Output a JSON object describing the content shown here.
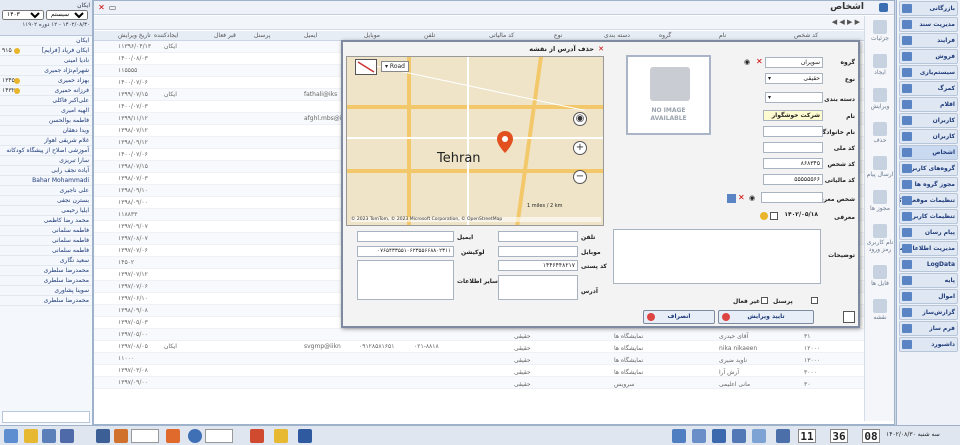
{
  "window_title": "اشخاص",
  "left_panel": {
    "title": "ایکان",
    "select_main": "ایکان سیستم",
    "select_year": "۱۴۰۳",
    "date_line": "۱۴۰۲/۰۸/۳۰ - ۱۲ دوره ۱۱۹۰۲",
    "rows": [
      {
        "text": "ایکان",
        "num": ""
      },
      {
        "text": "ایکان فریاد [فرایم]",
        "num": "۹۱۵"
      },
      {
        "text": "نادیا امینی",
        "num": ""
      },
      {
        "text": "شهرام‌نژاد جمیری",
        "num": ""
      },
      {
        "text": "بهزاد حمیری",
        "num": "۱۳۴۵"
      },
      {
        "text": "فرزانه حمیری",
        "num": "۱۴۳۲"
      },
      {
        "text": "علی‌اکبر فاکلی",
        "num": ""
      },
      {
        "text": "الهیه امیری",
        "num": ""
      },
      {
        "text": "فاطمه بوالحسن",
        "num": ""
      },
      {
        "text": "ویدا دهقان",
        "num": ""
      },
      {
        "text": "غلام شریفی اهواز",
        "num": ""
      },
      {
        "text": "آموزشی اصلاح از پیشگاه کودکانه",
        "num": ""
      },
      {
        "text": "سارا تبریزی",
        "num": ""
      },
      {
        "text": "آیاده نجف رابی",
        "num": ""
      },
      {
        "text": "Bahar Mohammadi",
        "num": ""
      },
      {
        "text": "علی ناجیری",
        "num": ""
      },
      {
        "text": "بسترن نجفی",
        "num": ""
      },
      {
        "text": "ایلیا رحیمی",
        "num": ""
      },
      {
        "text": "محمد رضا کاظمی",
        "num": ""
      },
      {
        "text": "فاطمه سلمانی",
        "num": ""
      },
      {
        "text": "فاطمه سلمانی",
        "num": ""
      },
      {
        "text": "فاطمه سلمانی",
        "num": ""
      },
      {
        "text": "سعید نگاری",
        "num": ""
      },
      {
        "text": "محمدرضا سلطری",
        "num": ""
      },
      {
        "text": "محمدرضا سلطری",
        "num": ""
      },
      {
        "text": "سوینا پشاوری",
        "num": ""
      },
      {
        "text": "محمدرضا سلطری",
        "num": ""
      }
    ]
  },
  "grid": {
    "headers": [
      "تاریخ ویرایش",
      "ایجادکننده",
      "قبر فعال",
      "پرسنل",
      "ایمیل",
      "موبایل",
      "تلفن",
      "کد مالیاتی",
      "نوع",
      "دسته بندی",
      "گروه",
      "نام",
      "کد شخص"
    ],
    "rows": [
      [
        "۱۱۳۹۶/۰۴/۱۳",
        "ایکان",
        "",
        "",
        "",
        "",
        ""
      ],
      [
        "۱۴۰۰/۰۸/۰۳",
        "",
        "",
        "",
        "",
        "",
        ""
      ],
      [
        "۱۱۵۵۵۵",
        "",
        "",
        "",
        "",
        "",
        ""
      ],
      [
        "۱۴۰۰/۰۷/۰۶",
        "",
        "",
        "",
        "",
        "",
        ""
      ],
      [
        "۱۳۹۹/۰۷/۱۵",
        "ایکان",
        "",
        "",
        "fathali@iks",
        "",
        ""
      ],
      [
        "۱۴۰۰/۰۷/۰۳",
        "",
        "",
        "",
        "",
        "",
        ""
      ],
      [
        "۱۳۹۹/۱۱/۱۲",
        "",
        "",
        "",
        "afghl.mbs@iks",
        "",
        ""
      ],
      [
        "۱۳۹۸/۰۷/۱۲",
        "",
        "",
        "",
        "",
        "",
        ""
      ],
      [
        "۱۳۹۸/۰۹/۱۲",
        "",
        "",
        "",
        "",
        "",
        ""
      ],
      [
        "۱۴۰۰/۰۷/۰۶",
        "",
        "",
        "",
        "",
        "",
        ""
      ],
      [
        "۱۳۹۸/۰۷/۱۵",
        "",
        "",
        "",
        "",
        "",
        ""
      ],
      [
        "۱۳۹۸/۰۷/۰۳",
        "",
        "",
        "",
        "",
        "",
        ""
      ],
      [
        "۱۳۹۸/۰۹/۱۰",
        "",
        "",
        "",
        "",
        "",
        ""
      ],
      [
        "۱۳۹۸/۰۹/۰۰",
        "",
        "",
        "",
        "",
        "",
        ""
      ],
      [
        "۱۱۸۸۳۳",
        "",
        "",
        "",
        "",
        "",
        ""
      ],
      [
        "۱۳۹۷/۰۹/۰۷",
        "",
        "",
        "",
        "",
        "",
        ""
      ],
      [
        "۱۳۹۷/۰۸/۰۷",
        "",
        "",
        "",
        "",
        "",
        ""
      ],
      [
        "۱۳۹۷/۰۷/۰۶",
        "",
        "",
        "",
        "",
        "",
        ""
      ],
      [
        "۱۴۵۰۲",
        "",
        "",
        "",
        "",
        "",
        ""
      ],
      [
        "۱۳۹۷/۰۷/۱۲",
        "",
        "",
        "",
        "",
        "",
        ""
      ],
      [
        "۱۳۹۷/۰۷/۰۶",
        "",
        "",
        "",
        "",
        "",
        ""
      ],
      [
        "۱۳۹۷/۰۶/۱۰",
        "",
        "",
        "",
        "",
        "",
        ""
      ],
      [
        "۱۳۹۸/۰۹/۰۸",
        "",
        "",
        "",
        "",
        "",
        ""
      ],
      [
        "۱۳۹۷/۰۵/۰۳",
        "",
        "",
        "",
        "",
        "",
        ""
      ],
      [
        "۱۳۹۷/۰۵/۰۰",
        "",
        "",
        "",
        "",
        "",
        ""
      ],
      [
        "۱۳۹۷/۰۸/۰۵",
        "ایکان",
        "",
        "",
        "svgmp@iikn",
        "۰۹۱۲۸۵۸۱۶۵۱",
        "۰۲۱-۸۸۱۸"
      ],
      [
        "۱۱۰۰۰",
        "",
        "",
        "",
        "",
        "",
        ""
      ],
      [
        "۱۳۹۷/۰۳/۰۸",
        "",
        "",
        "",
        "",
        "",
        ""
      ],
      [
        "۱۳۹۷/۰۹/۰۰",
        "",
        "",
        "",
        "",
        "",
        ""
      ]
    ],
    "bottom_rows": [
      {
        "code": "۳۱",
        "name": "آقای حیدری",
        "group": "نمایشگاه ها",
        "type": "حقیقی"
      },
      {
        "code": "۱۲۰۰۰",
        "name": "nika nikaeen",
        "group": "نمایشگاه ها",
        "type": "حقیقی"
      },
      {
        "code": "۱۳۰۰۰",
        "name": "ناوید ضیری",
        "group": "نمایشگاه ها",
        "type": "حقیقی"
      },
      {
        "code": "۳۰۰۰",
        "name": "آرش آرا",
        "group": "نمایشگاه ها",
        "type": "حقیقی"
      },
      {
        "code": "۳۰",
        "name": "مانی اعلیمی",
        "group": "سرویس",
        "type": "حقیقی"
      }
    ]
  },
  "actions": [
    {
      "label": "جزئیات",
      "icon": "details-icon"
    },
    {
      "label": "ایجاد",
      "icon": "create-icon"
    },
    {
      "label": "ویرایش",
      "icon": "edit-icon"
    },
    {
      "label": "حذف",
      "icon": "delete-icon"
    },
    {
      "label": "ارسال پیام",
      "icon": "message-icon"
    },
    {
      "label": "مجوز ها",
      "icon": "permissions-icon"
    },
    {
      "label": "نام کاربری رمز ورود",
      "icon": "login-icon"
    },
    {
      "label": "فایل ها",
      "icon": "files-icon"
    },
    {
      "label": "نقشه",
      "icon": "map-icon"
    }
  ],
  "right_nav": [
    "بازرگانی",
    "مدیریت سند",
    "فرایند",
    "فروش",
    "سیستم‌یاری",
    "کمرگ",
    "اقلام",
    "کاربران",
    "کاربران",
    "اشخاص",
    "گروه‌های کاربری",
    "مجوز گروه ها",
    "تنظیمات موقعیت کاربران",
    "تنظیمات کاربران",
    "پیام رسان",
    "مدیریت اطلاعات سیستم",
    "LogData",
    "پایه",
    "اموال",
    "گزارش‌ساز",
    "فرم ساز",
    "داشبورد"
  ],
  "dialog": {
    "map_title": "حذف آدرس از نقشه",
    "map_type": "Road",
    "map_city": "Tehran",
    "map_attrib": "© 2023 TomTom, © 2023 Microsoft Corporation, © OpenStreetMap",
    "map_scale_km": "2 km",
    "map_scale_mi": "1 miles",
    "no_image": "NO IMAGE",
    "no_image_sub": "AVAILABLE",
    "labels": {
      "group": "گروه",
      "type": "نوع",
      "category": "دسته بندی",
      "name": "نام",
      "family": "نام خانوادگی",
      "national": "کد ملی",
      "person_code": "کد شخص",
      "tax_code": "کد مالیاتی",
      "introducer": "شخص معرف",
      "date": "معرفی",
      "phone": "تلفن",
      "email": "ایمیل",
      "mobile": "موبایل",
      "location": "لوکیشن",
      "postal": "کد پستی",
      "address": "آدرس",
      "other_info": "سایر اطلاعات",
      "description": "توضیحات",
      "personnel": "پرسنل",
      "inactive": "غیر فعال"
    },
    "values": {
      "group": "سوپران",
      "type": "حقیقی",
      "category": "",
      "name": "شرکت خوشگوار",
      "family": "",
      "national": "",
      "person_code": "۸۶۸۳۴۵",
      "tax_code": "۵۵۵۵۵۵۶۶",
      "introducer": "",
      "date": "۱۴۰۲/۰۵/۱۸",
      "phone": "",
      "email": "",
      "mobile": "",
      "location": "۰۷۶۵۴۳۳۵۵۱۰۶۲۳۵۵۶۶۸۸۰۲۳۱۱",
      "postal": "۱۴۴۶۴۴۸۲۱۷",
      "address": "",
      "other_info": ""
    },
    "buttons": {
      "confirm": "تایید ویرایش",
      "cancel": "انصراف"
    }
  },
  "taskbar": {
    "date": "سه شنبه ۱۴۰۲/۰۸/۳۰",
    "clock": [
      "11",
      "36",
      "08"
    ]
  }
}
